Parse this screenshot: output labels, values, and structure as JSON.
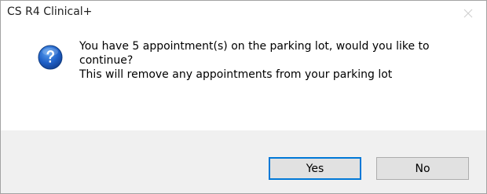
{
  "window": {
    "title": "CS R4 Clinical+"
  },
  "dialog": {
    "icon": "question-icon",
    "message_line1": "You have 5 appointment(s) on the parking lot, would you like to",
    "message_line2": "continue?",
    "message_line3": "This will remove any appointments from your parking lot"
  },
  "buttons": {
    "yes_label": "Yes",
    "no_label": "No"
  },
  "colors": {
    "accent": "#0078d7",
    "footer_bg": "#f0f0f0",
    "button_bg": "#e1e1e1"
  }
}
